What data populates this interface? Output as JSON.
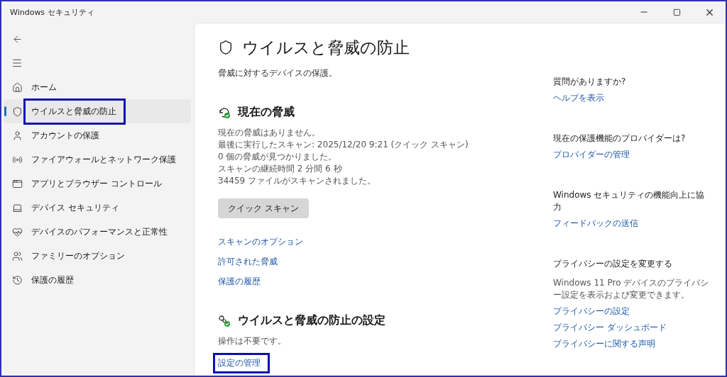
{
  "window": {
    "title": "Windows セキュリティ"
  },
  "sidebar": {
    "items": [
      {
        "label": "ホーム",
        "selected": false,
        "highlighted": false
      },
      {
        "label": "ウイルスと脅威の防止",
        "selected": true,
        "highlighted": true
      },
      {
        "label": "アカウントの保護",
        "selected": false,
        "highlighted": false
      },
      {
        "label": "ファイアウォールとネットワーク保護",
        "selected": false,
        "highlighted": false
      },
      {
        "label": "アプリとブラウザー コントロール",
        "selected": false,
        "highlighted": false
      },
      {
        "label": "デバイス セキュリティ",
        "selected": false,
        "highlighted": false
      },
      {
        "label": "デバイスのパフォーマンスと正常性",
        "selected": false,
        "highlighted": false
      },
      {
        "label": "ファミリーのオプション",
        "selected": false,
        "highlighted": false
      },
      {
        "label": "保護の履歴",
        "selected": false,
        "highlighted": false
      }
    ]
  },
  "main": {
    "title": "ウイルスと脅威の防止",
    "subtitle": "脅威に対するデバイスの保護。",
    "sections": [
      {
        "kind": "threats",
        "heading": "現在の脅威",
        "lines": [
          "現在の脅威はありません。",
          "最後に実行したスキャン: 2025/12/20 9:21 (クイック スキャン)",
          "0 個の脅威が見つかりました。",
          "スキャンの継続時間 2 分間 6 秒",
          "34459 ファイルがスキャンされました。"
        ],
        "button": "クイック スキャン",
        "links": [
          {
            "label": "スキャンのオプション",
            "highlighted": false
          },
          {
            "label": "許可された脅威",
            "highlighted": false
          },
          {
            "label": "保護の履歴",
            "highlighted": false
          }
        ]
      },
      {
        "kind": "settings",
        "heading": "ウイルスと脅威の防止の設定",
        "lines": [
          "操作は不要です。"
        ],
        "links": [
          {
            "label": "設定の管理",
            "highlighted": true
          }
        ]
      }
    ]
  },
  "aside": [
    {
      "heading": "質問がありますか?",
      "links": [
        "ヘルプを表示"
      ]
    },
    {
      "heading": "現在の保護機能のプロバイダーは?",
      "links": [
        "プロバイダーの管理"
      ]
    },
    {
      "heading": "Windows セキュリティの機能向上に協力",
      "links": [
        "フィードバックの送信"
      ]
    },
    {
      "heading": "プライバシーの設定を変更する",
      "text": "Windows 11 Pro デバイスのプライバシー設定を表示および変更できます。",
      "links": [
        "プライバシーの設定",
        "プライバシー ダッシュボード",
        "プライバシーに関する声明"
      ]
    }
  ]
}
